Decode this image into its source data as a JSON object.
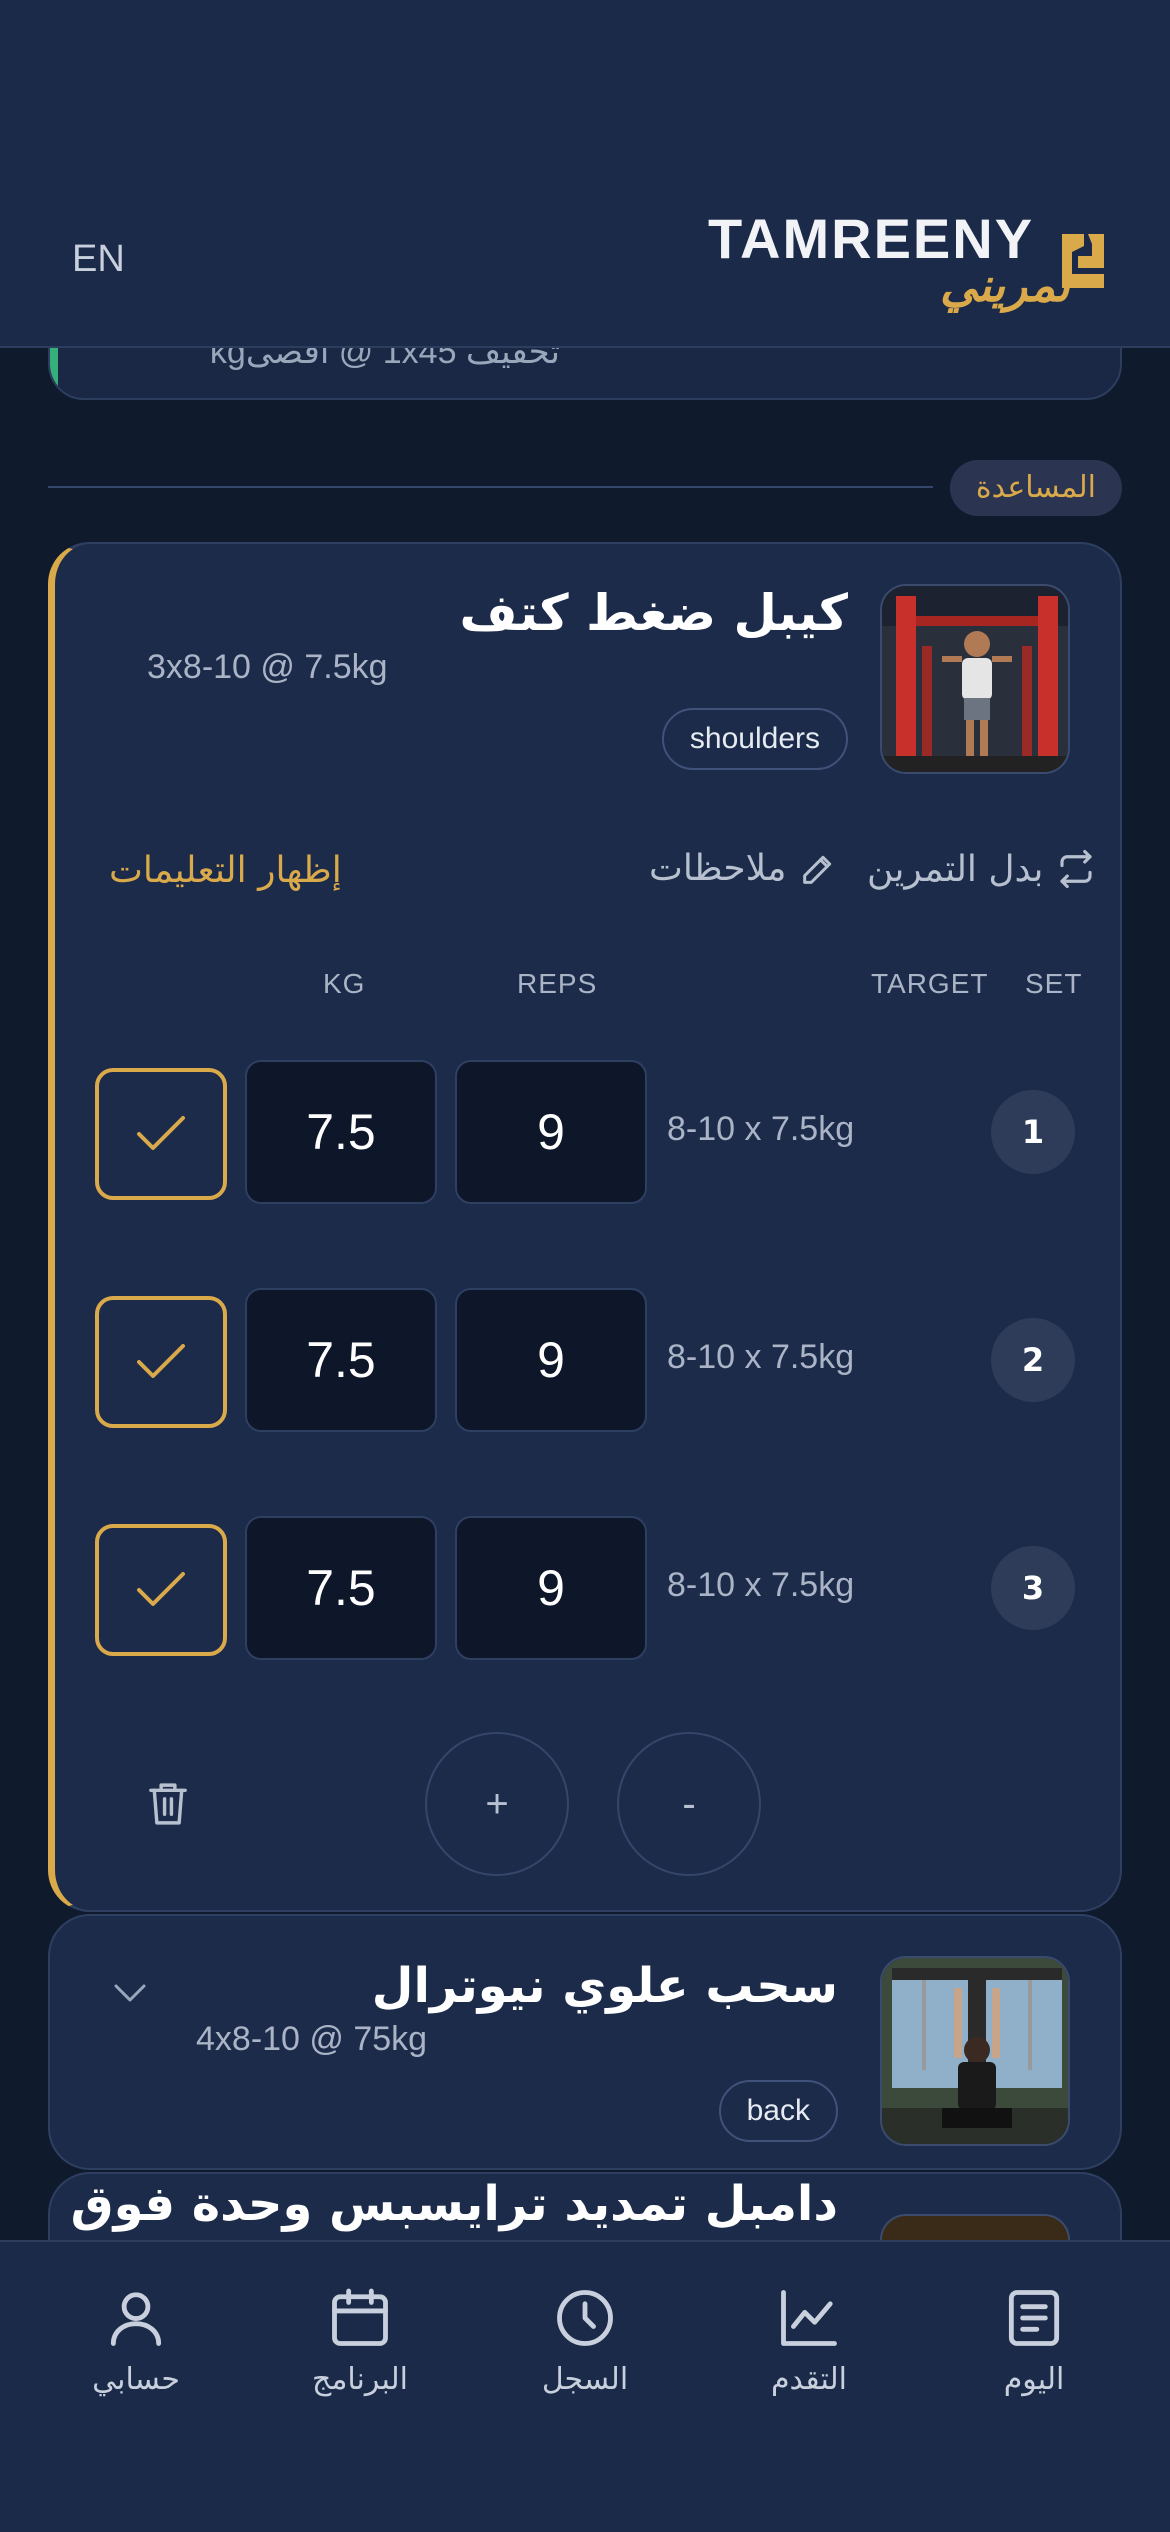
{
  "header": {
    "lang_toggle": "EN",
    "brand_latin": "TAMREENY",
    "brand_arabic": "تمريني",
    "accent_color": "#d9a94a"
  },
  "previous_card": {
    "subtitle": "تخفيف 1x45 @ أقصىkg"
  },
  "section": {
    "label": "المساعدة"
  },
  "active_exercise": {
    "title": "كيبل ضغط كتف",
    "scheme": "3x8-10 @ 7.5kg",
    "tag": "shoulders",
    "actions": {
      "instructions": "إظهار التعليمات",
      "notes": "ملاحظات",
      "swap": "بدل التمرين"
    },
    "columns": {
      "kg": "KG",
      "reps": "REPS",
      "target": "TARGET",
      "set": "SET"
    },
    "sets": [
      {
        "num": "1",
        "target": "8-10 x 7.5kg",
        "kg": "7.5",
        "reps": "9",
        "done": true
      },
      {
        "num": "2",
        "target": "8-10 x 7.5kg",
        "kg": "7.5",
        "reps": "9",
        "done": true
      },
      {
        "num": "3",
        "target": "8-10 x 7.5kg",
        "kg": "7.5",
        "reps": "9",
        "done": true
      }
    ],
    "add_set": "+",
    "remove_set": "-"
  },
  "next_exercise": {
    "title": "سحب علوي نيوترال",
    "scheme": "4x8-10 @ 75kg",
    "tag": "back"
  },
  "following_exercise": {
    "title": "دامبل تمديد ترايسبس وحدة فوق"
  },
  "bottom_nav": [
    {
      "label": "حسابي",
      "icon": "user-icon"
    },
    {
      "label": "البرنامج",
      "icon": "calendar-icon"
    },
    {
      "label": "السجل",
      "icon": "clock-icon"
    },
    {
      "label": "التقدم",
      "icon": "chart-line-icon"
    },
    {
      "label": "اليوم",
      "icon": "list-icon"
    }
  ]
}
